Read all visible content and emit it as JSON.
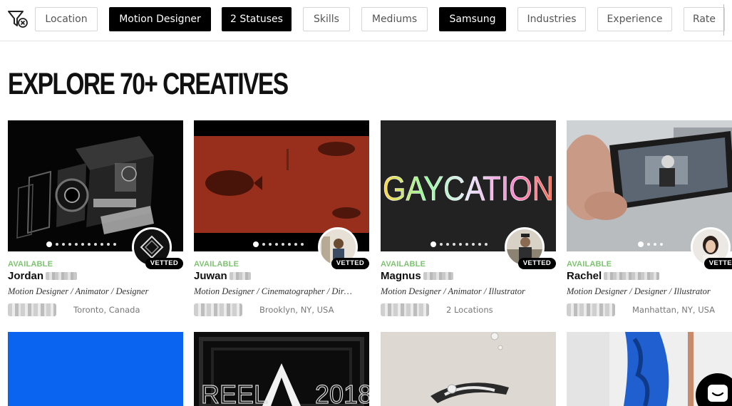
{
  "filters": [
    {
      "label": "Location",
      "active": false
    },
    {
      "label": "Motion Designer",
      "active": true
    },
    {
      "label": "2 Statuses",
      "active": true
    },
    {
      "label": "Skills",
      "active": false
    },
    {
      "label": "Mediums",
      "active": false
    },
    {
      "label": "Samsung",
      "active": true
    },
    {
      "label": "Industries",
      "active": false
    },
    {
      "label": "Experience",
      "active": false
    },
    {
      "label": "Rate",
      "active": false
    }
  ],
  "page_title": "EXPLORE 70+ CREATIVES",
  "cards": [
    {
      "status": "AVAILABLE",
      "first_name": "Jordan",
      "badge": "VETTED",
      "roles": "Motion Designer / Animator / Designer",
      "location": "Toronto, Canada",
      "active_slide": 1,
      "slide_count": 11
    },
    {
      "status": "AVAILABLE",
      "first_name": "Juwan",
      "badge": "VETTED",
      "roles": "Motion Designer / Cinematographer / Dir…",
      "location": "Brooklyn, NY, USA",
      "active_slide": 1,
      "slide_count": 8
    },
    {
      "status": "AVAILABLE",
      "first_name": "Magnus",
      "badge": "VETTED",
      "roles": "Motion Designer / Animator / Illustrator",
      "location": "2 Locations",
      "active_slide": 1,
      "slide_count": 9
    },
    {
      "status": "AVAILABLE",
      "first_name": "Rachel",
      "badge": "VETTED",
      "roles": "Motion Designer / Designer / Illustrator",
      "location": "Manhattan, NY, USA",
      "active_slide": 1,
      "slide_count": 4
    }
  ],
  "thumbnail_texts": {
    "card3_headline": "GAYCATION",
    "row2_card2_left": "REEL",
    "row2_card2_right": "2018"
  },
  "colors": {
    "accent_available": "#7cc46f",
    "chip_active_bg": "#000000",
    "row2_card1_bg": "#0a64f0"
  },
  "icons": {
    "filter_clear": "filter-clear-icon",
    "chat": "chat-icon"
  }
}
